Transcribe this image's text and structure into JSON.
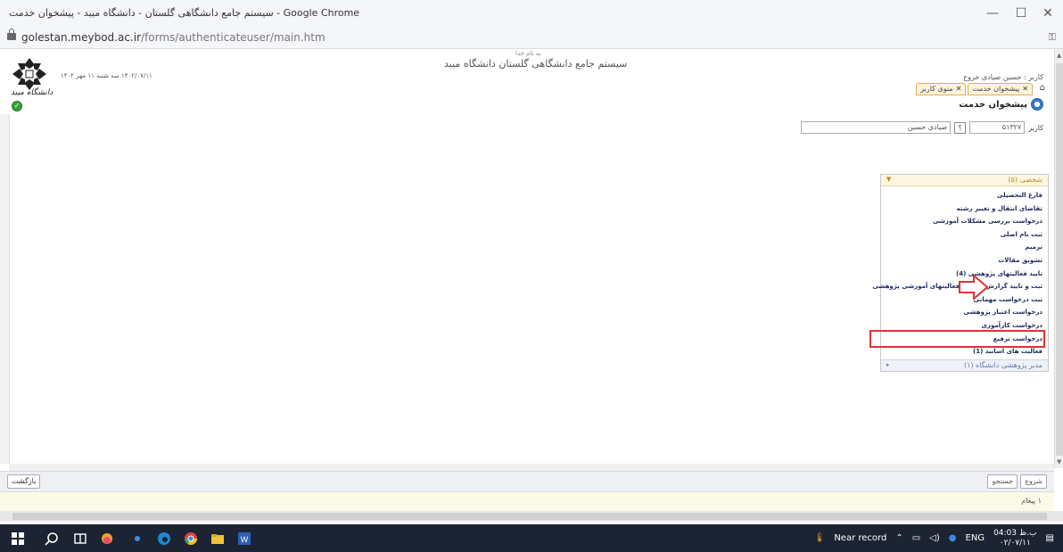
{
  "browser": {
    "window_title": "سیستم جامع دانشگاهی گلستان - دانشگاه میبد - پیشخوان خدمت - Google Chrome",
    "url_host": "golestan.meybod.ac.ir",
    "url_path": "/forms/authenticateuser/main.htm",
    "min": "—",
    "max": "☐",
    "close": "✕"
  },
  "header": {
    "small": "به نام خدا",
    "title": "سیستم جامع دانشگاهی گلستان   دانشگاه میبد",
    "date": "۱۴۰۲/۰۷/۱۱ سه شنبه ۱۱ مهر ۱۴۰۲",
    "logo_text": "دانشگاه میبد",
    "user_line": "کاربر : حسین صیادی   خروج"
  },
  "tabs": [
    {
      "label": "منوی کاربر"
    },
    {
      "label": "پیشخوان خدمت"
    }
  ],
  "service": {
    "title": "پیشخوان خدمت",
    "user_label": "کاربر",
    "user_code": "۵۱۳۲۷",
    "help": "؟",
    "user_name": "صیادی حسین"
  },
  "panel": {
    "header": "شخصی (۵)",
    "items": [
      "فارغ التحصیلی",
      "تقاضای انتقال و تغییر رشته",
      "درخواست بررسی مشکلات آموزشی",
      "ثبت نام اصلی",
      "ترمیم",
      "تشویق مقالات",
      "تایید فعالیتهای پژوهشی (4)",
      "ثبت و تایید گزارش عملکرد فعالیتهای آموزشی پژوهشی",
      "ثبت درخواست مهمانی",
      "درخواست اعتبار پژوهشی",
      "درخواست کارآموزی",
      "درخواست ترفیع",
      "فعالیت های اساتید (1)"
    ],
    "selected": "درخواست ترفیع",
    "footer": "مدیر پژوهشی دانشگاه (۱)"
  },
  "bottom": {
    "back": "بازگشت",
    "refresh": "شروع",
    "stop": "جستجو",
    "message": "۱ پیغام"
  },
  "taskbar": {
    "weather": "Near record",
    "lang": "ENG",
    "time": "04:03 ب.ظ",
    "date": "۰۲/۰۷/۱۱"
  }
}
